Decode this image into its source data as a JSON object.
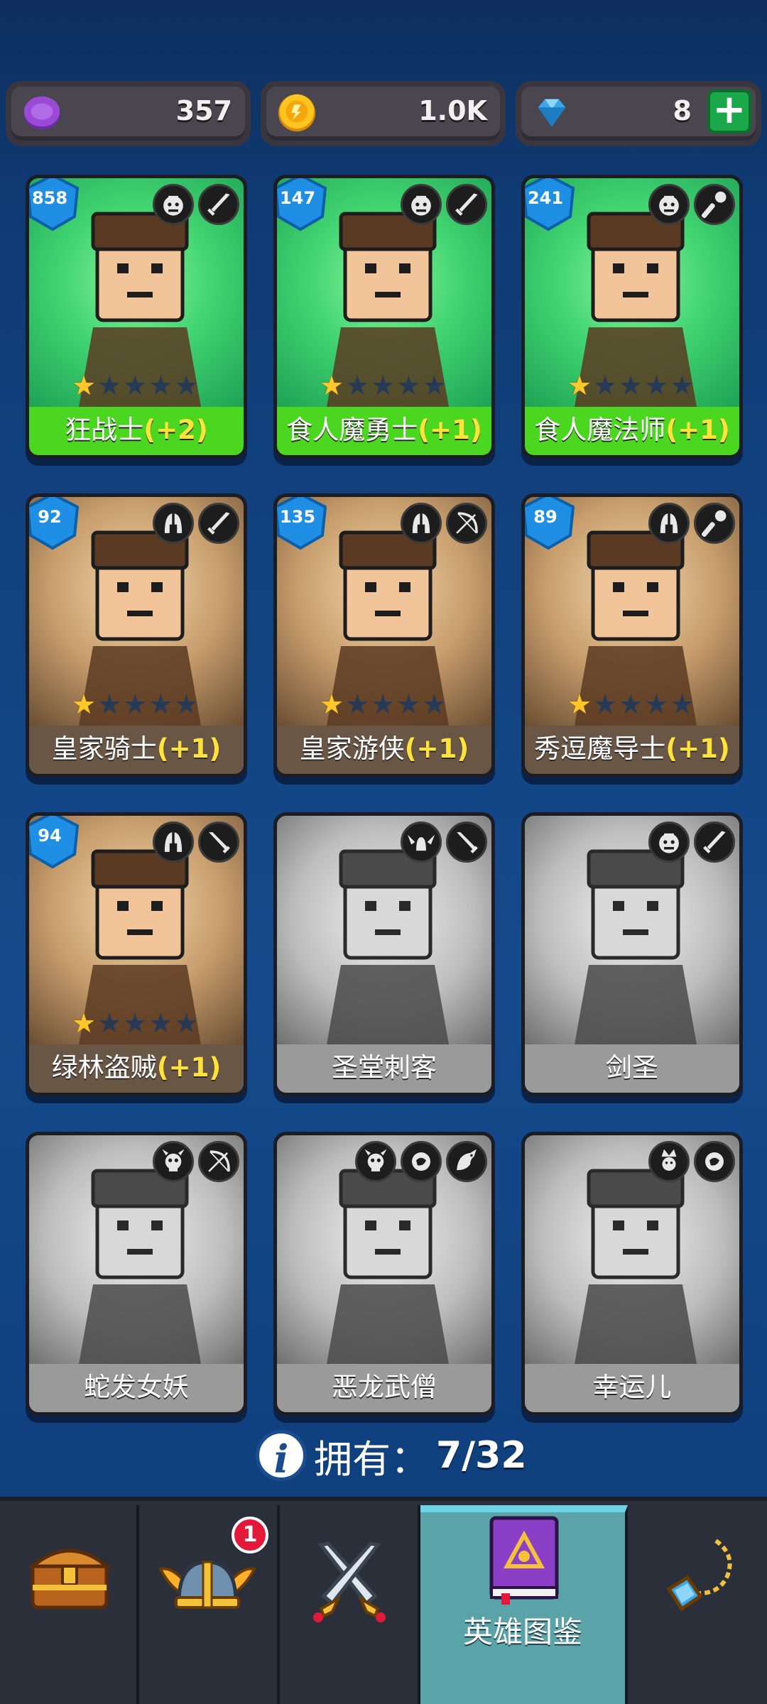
{
  "currency": {
    "gem_purple": {
      "icon": "purple-coin-icon",
      "value": "357"
    },
    "gold": {
      "icon": "gold-coin-icon",
      "value": "1.0K"
    },
    "diamond": {
      "icon": "diamond-icon",
      "value": "8",
      "add_label": "+"
    }
  },
  "heroes": [
    {
      "name": "狂战士",
      "bonus": "(+2)",
      "level": "858",
      "stars": 1,
      "owned": true,
      "icons": [
        "orc-face-icon",
        "sword-icon"
      ]
    },
    {
      "name": "食人魔勇士",
      "bonus": "(+1)",
      "level": "147",
      "stars": 1,
      "owned": true,
      "icons": [
        "orc-face-icon",
        "sword-icon"
      ]
    },
    {
      "name": "食人魔法师",
      "bonus": "(+1)",
      "level": "241",
      "stars": 1,
      "owned": true,
      "icons": [
        "orc-face-icon",
        "wand-icon"
      ]
    },
    {
      "name": "皇家骑士",
      "bonus": "(+1)",
      "level": "92",
      "stars": 1,
      "owned": true,
      "icons": [
        "helmet-icon",
        "sword-icon"
      ]
    },
    {
      "name": "皇家游侠",
      "bonus": "(+1)",
      "level": "135",
      "stars": 1,
      "owned": true,
      "icons": [
        "helmet-icon",
        "bow-icon"
      ]
    },
    {
      "name": "秀逗魔导士",
      "bonus": "(+1)",
      "level": "89",
      "stars": 1,
      "owned": true,
      "icons": [
        "helmet-icon",
        "wand-icon"
      ]
    },
    {
      "name": "绿林盗贼",
      "bonus": "(+1)",
      "level": "94",
      "stars": 1,
      "owned": true,
      "icons": [
        "helmet-icon",
        "dagger-icon"
      ]
    },
    {
      "name": "圣堂刺客",
      "bonus": "",
      "level": "",
      "stars": 0,
      "owned": false,
      "icons": [
        "winged-helm-icon",
        "dagger-icon"
      ]
    },
    {
      "name": "剑圣",
      "bonus": "",
      "level": "",
      "stars": 0,
      "owned": false,
      "icons": [
        "orc-face-icon",
        "sword-icon"
      ]
    },
    {
      "name": "蛇发女妖",
      "bonus": "",
      "level": "",
      "stars": 0,
      "owned": false,
      "icons": [
        "demon-skull-icon",
        "bow-icon"
      ]
    },
    {
      "name": "恶龙武僧",
      "bonus": "",
      "level": "",
      "stars": 0,
      "owned": false,
      "icons": [
        "demon-skull-icon",
        "fist-icon",
        "dragon-icon"
      ]
    },
    {
      "name": "幸运儿",
      "bonus": "",
      "level": "",
      "stars": 0,
      "owned": false,
      "icons": [
        "jester-icon",
        "fist-icon"
      ]
    }
  ],
  "owned_label": "拥有：",
  "owned_count": "7/32",
  "nav": {
    "tabs": [
      {
        "icon": "treasure-chest-icon",
        "label": ""
      },
      {
        "icon": "viking-helmet-icon",
        "label": "",
        "badge": "1"
      },
      {
        "icon": "crossed-swords-icon",
        "label": ""
      },
      {
        "icon": "hero-book-icon",
        "label": "英雄图鉴",
        "active": true
      },
      {
        "icon": "amulet-icon",
        "label": ""
      }
    ]
  },
  "colors": {
    "owned_green": "#4bd61f",
    "owned_brown": "#6a5644",
    "locked_gray": "#9a9a9a",
    "bonus_yellow": "#ffe23a",
    "active_tab": "#5aa3a9"
  }
}
